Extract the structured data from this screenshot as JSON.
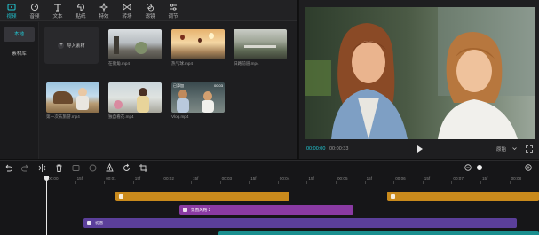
{
  "toolbar": {
    "items": [
      {
        "label": "视频",
        "icon": "video-icon",
        "active": true
      },
      {
        "label": "音频",
        "icon": "audio-icon"
      },
      {
        "label": "文本",
        "icon": "text-icon"
      },
      {
        "label": "贴纸",
        "icon": "sticker-icon"
      },
      {
        "label": "特效",
        "icon": "effects-icon"
      },
      {
        "label": "转场",
        "icon": "transition-icon"
      },
      {
        "label": "滤镜",
        "icon": "filter-icon"
      },
      {
        "label": "调节",
        "icon": "adjust-icon"
      }
    ]
  },
  "side_nav": {
    "items": [
      {
        "label": "本地",
        "active": true
      },
      {
        "label": "素材库"
      }
    ]
  },
  "media": {
    "import_label": "导入素材",
    "clips": [
      {
        "name": "在街角.mp4"
      },
      {
        "name": "热气球.mp4"
      },
      {
        "name": "旧路前道.mp4"
      },
      {
        "name": "第一次去旅游.mp4"
      },
      {
        "name": "独自看花.mp4"
      },
      {
        "name": "Vlog.mp4",
        "duration": "00:03",
        "badge": "已添加"
      }
    ]
  },
  "preview": {
    "current_time": "00:00:00",
    "total_time": "00:00:33",
    "ratio_label": "原始"
  },
  "timeline": {
    "ruler": [
      "00:00",
      "15f",
      "00:01",
      "15f",
      "00:02",
      "15f",
      "00:03",
      "15f",
      "00:04",
      "15f",
      "00:05",
      "15f",
      "00:06",
      "15f",
      "00:07",
      "15f",
      "00:08"
    ],
    "clips": [
      {
        "label": "",
        "color": "#c98a1c"
      },
      {
        "label": "",
        "color": "#c98a1c"
      },
      {
        "label": "氛围风格 2",
        "color": "#8a3aa3"
      },
      {
        "label": "初音",
        "color": "#5b3f9a"
      },
      {
        "label": "",
        "color": "#1a8f8f"
      }
    ]
  },
  "colors": {
    "accent": "#21c8d4",
    "panel": "#1e1e20",
    "timeline_bg": "#161618"
  }
}
